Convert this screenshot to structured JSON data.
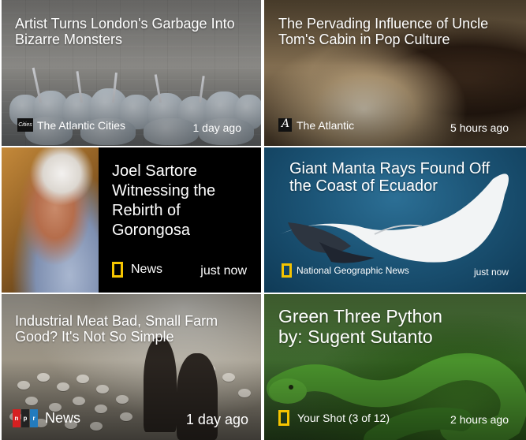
{
  "cards": [
    {
      "title": "Artist Turns London's Garbage Into Bizarre Monsters",
      "source": "The Atlantic Cities",
      "source_icon": "the-atlantic-cities-logo",
      "logo_text": "Cities",
      "time": "1 day ago"
    },
    {
      "title": "The Pervading Influence of Uncle Tom's Cabin in Pop Culture",
      "source": "The Atlantic",
      "source_icon": "the-atlantic-logo",
      "time": "5 hours ago"
    },
    {
      "title": "Joel Sartore Witnessing the Rebirth of Gorongosa",
      "source": "News",
      "source_icon": "national-geographic-logo",
      "time": "just now"
    },
    {
      "title": "Giant Manta Rays Found Off the Coast of Ecuador",
      "source": "National Geographic News",
      "source_icon": "national-geographic-logo",
      "time": "just now"
    },
    {
      "title": "Industrial Meat Bad, Small Farm Good? It's Not So Simple",
      "source": "News",
      "source_icon": "npr-logo",
      "logo_letters": [
        "n",
        "p",
        "r"
      ],
      "time": "1 day ago"
    },
    {
      "title": "Green Three Python by: Sugent Sutanto",
      "source": "Your Shot (3 of 12)",
      "source_icon": "national-geographic-logo",
      "time": "2 hours ago"
    }
  ],
  "colors": {
    "ng_yellow": "#f5c400",
    "npr_red": "#d62021",
    "npr_black": "#222222",
    "npr_blue": "#237bbd"
  }
}
